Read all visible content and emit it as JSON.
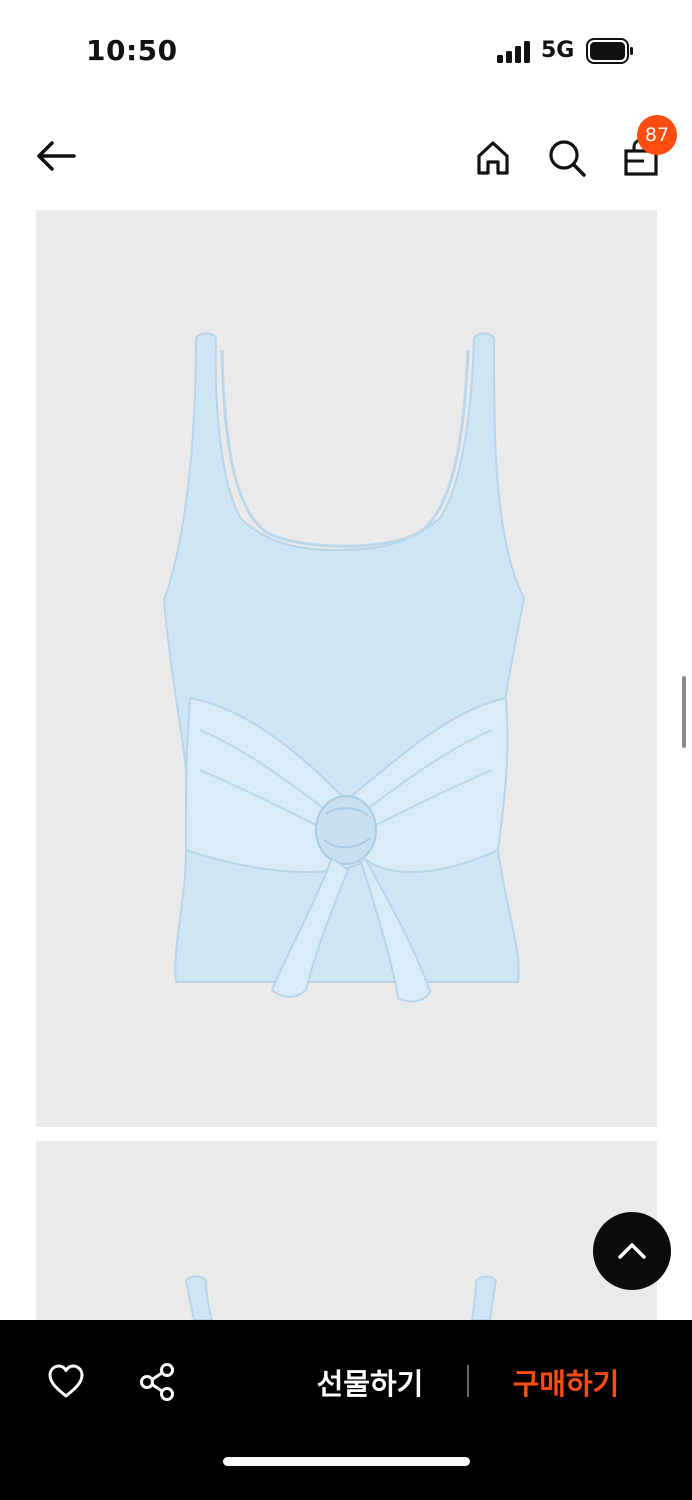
{
  "status_bar": {
    "time": "10:50",
    "network": "5G"
  },
  "header": {
    "cart_count": "87"
  },
  "icons": {
    "back": "back-arrow-icon",
    "home": "home-icon",
    "search": "search-icon",
    "cart": "shopping-bag-icon",
    "scroll_top": "chevron-up-icon",
    "like": "heart-icon",
    "share": "share-icon"
  },
  "product": {
    "images": [
      {
        "subject": "light blue tie-front tank top"
      },
      {
        "subject": "light blue tie-front tank top"
      }
    ]
  },
  "bottom_bar": {
    "gift_label": "선물하기",
    "buy_label": "구매하기"
  },
  "colors": {
    "accent": "#ff4c0f",
    "bar_bg": "#000000",
    "image_bg": "#ebebeb",
    "garment": "#cfe6f5"
  }
}
